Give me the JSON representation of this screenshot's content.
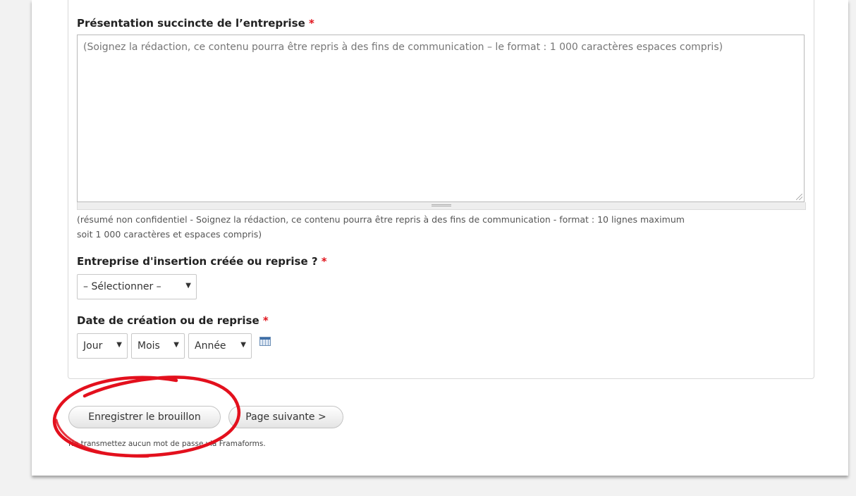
{
  "form": {
    "presentation": {
      "label": "Présentation succincte de l’entreprise",
      "required_marker": "*",
      "placeholder": "(Soignez la rédaction, ce contenu pourra être repris à des fins de communication – le format : 1 000 caractères espaces compris)",
      "description_line1": "(résumé non confidentiel - Soignez la rédaction, ce contenu pourra être repris à des fins de communication - format : 10 lignes maximum",
      "description_line2": "soit 1 000 caractères et espaces compris)"
    },
    "insertion": {
      "label": "Entreprise d'insertion créée ou reprise ?",
      "required_marker": "*",
      "selected": "– Sélectionner –"
    },
    "date": {
      "label": "Date de création ou de reprise",
      "required_marker": "*",
      "day": "Jour",
      "month": "Mois",
      "year": "Année",
      "calendar_icon": "calendar-icon"
    }
  },
  "actions": {
    "save_draft": "Enregistrer le brouillon",
    "next_page": "Page suivante >"
  },
  "footnote": "Ne transmettez aucun mot de passe via Framaforms.",
  "colors": {
    "required": "#e0131b",
    "annotation_circle": "#e3101d"
  }
}
